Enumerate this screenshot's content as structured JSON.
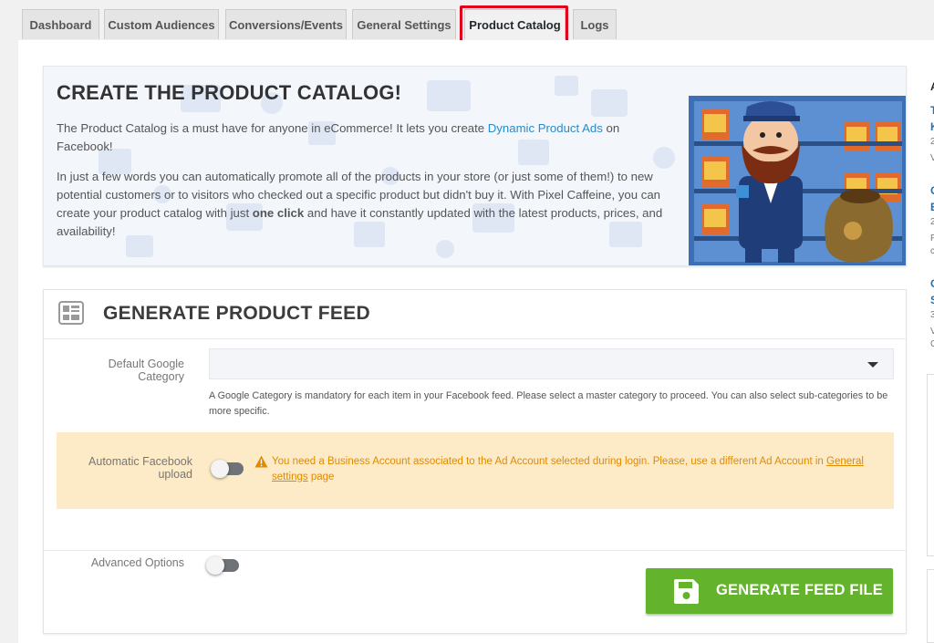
{
  "tabs": [
    {
      "label": "Dashboard",
      "active": false
    },
    {
      "label": "Custom Audiences",
      "active": false
    },
    {
      "label": "Conversions/Events",
      "active": false
    },
    {
      "label": "General Settings",
      "active": false
    },
    {
      "label": "Product Catalog",
      "active": true
    },
    {
      "label": "Logs",
      "active": false
    }
  ],
  "hero": {
    "title": "CREATE THE PRODUCT CATALOG!",
    "p1_before": "The Product Catalog is a must have for anyone in eCommerce! It lets you create ",
    "p1_link": "Dynamic Product Ads",
    "p1_after": " on Facebook!",
    "p2_before": "In just a few words you can automatically promote all of the products in your store (or just some of them!) to new potential customers or to visitors who checked out a specific product but didn't buy it. With Pixel Caffeine, you can create your product catalog with just ",
    "p2_bold": "one click",
    "p2_after": " and have it constantly updated with the latest products, prices, and availability!"
  },
  "feed": {
    "title": "GENERATE PRODUCT FEED",
    "google_category_label": "Default Google Category",
    "google_category_value": "",
    "google_category_help": "A Google Category is mandatory for each item in your Facebook feed. Please select a master category to proceed. You can also select sub-categories to be more specific.",
    "auto_upload_label": "Automatic Facebook upload",
    "auto_upload_enabled": false,
    "warning_before": "You need a Business Account associated to the Ad Account selected during login. Please, use a different Ad Account in ",
    "warning_link": "General settings",
    "warning_after": " page",
    "advanced_label": "Advanced Options",
    "advanced_enabled": false,
    "generate_button": "GENERATE FEED FILE"
  },
  "sidebar_fragments": {
    "heading": "A",
    "link1_a": "T",
    "link1_b": "K",
    "meta1": "2",
    "desc1": "V",
    "link2_a": "C",
    "link2_b": "E",
    "meta2": "2",
    "desc2_a": "F",
    "desc2_b": "c",
    "link3_a": "C",
    "link3_b": "S",
    "meta3": "3",
    "desc3_a": "V",
    "desc3_b": "C"
  },
  "colors": {
    "accent_link": "#2a8bc6",
    "highlight_border": "#e0001b",
    "warning_bg": "#fdebc8",
    "warning_text": "#e08a00",
    "primary_button": "#64b32c"
  },
  "icons": {
    "panel": "catalog-grid-icon",
    "warning": "warning-triangle-icon",
    "button": "floppy-disk-icon"
  }
}
